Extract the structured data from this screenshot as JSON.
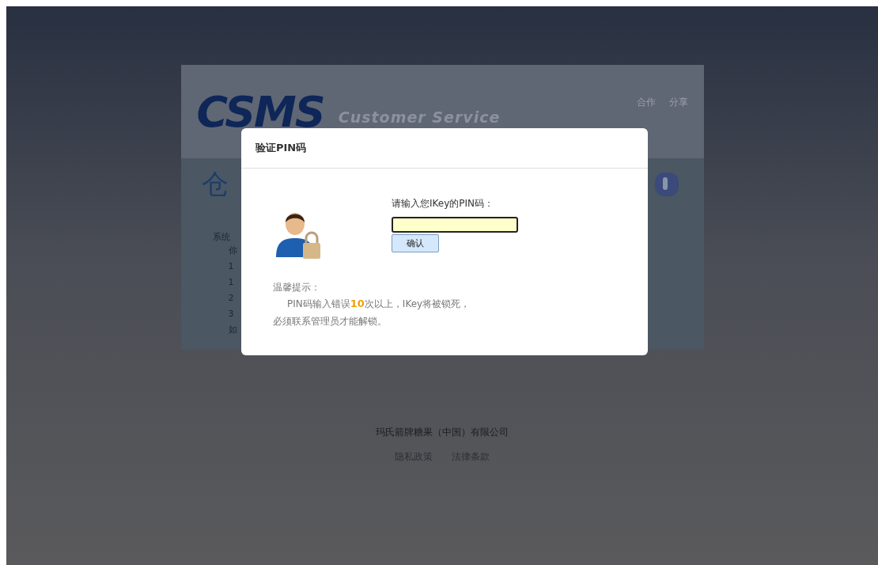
{
  "background_page": {
    "logo": "CSMS",
    "tagline": "Customer Service",
    "header_links": [
      "合作",
      "分享"
    ],
    "heading": "仓",
    "intro": "系统",
    "list_marks": [
      "你",
      "1",
      "1",
      "2",
      "3",
      "如"
    ]
  },
  "dialog": {
    "title": "验证PIN码",
    "prompt": "请输入您IKey的PIN码：",
    "confirm_button": "确认",
    "tip_title": "温馨提示：",
    "tip_lines": [
      "PIN码输入错误**10**次以上，IKey将被锁死，",
      "必须联系管理员才能解锁。"
    ]
  },
  "footer": {
    "company": "玛氏箭牌糖果（中国）有限公司",
    "links": [
      "隐私政策",
      "法律条款"
    ]
  }
}
